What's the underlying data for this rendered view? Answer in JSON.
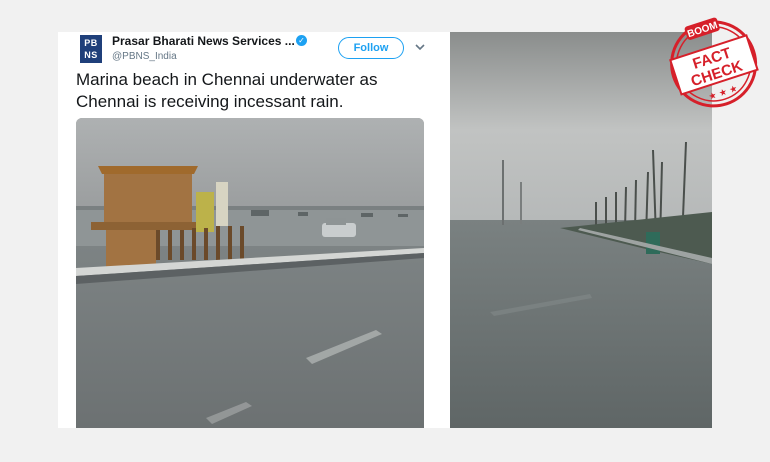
{
  "tweet": {
    "avatar_line1": "PB",
    "avatar_line2": "NS",
    "account_name": "Prasar Bharati News Services ...",
    "handle": "@PBNS_India",
    "follow_label": "Follow",
    "text": "Marina beach in Chennai underwater as Chennai is receiving incessant rain."
  },
  "stamp": {
    "brand": "BOOM",
    "line1": "FACT",
    "line2": "CHECK",
    "stars": "★ ★ ★"
  },
  "colors": {
    "twitter_blue": "#1da1f2",
    "stamp_red": "#d6202a",
    "avatar_navy": "#1f3f7a"
  }
}
